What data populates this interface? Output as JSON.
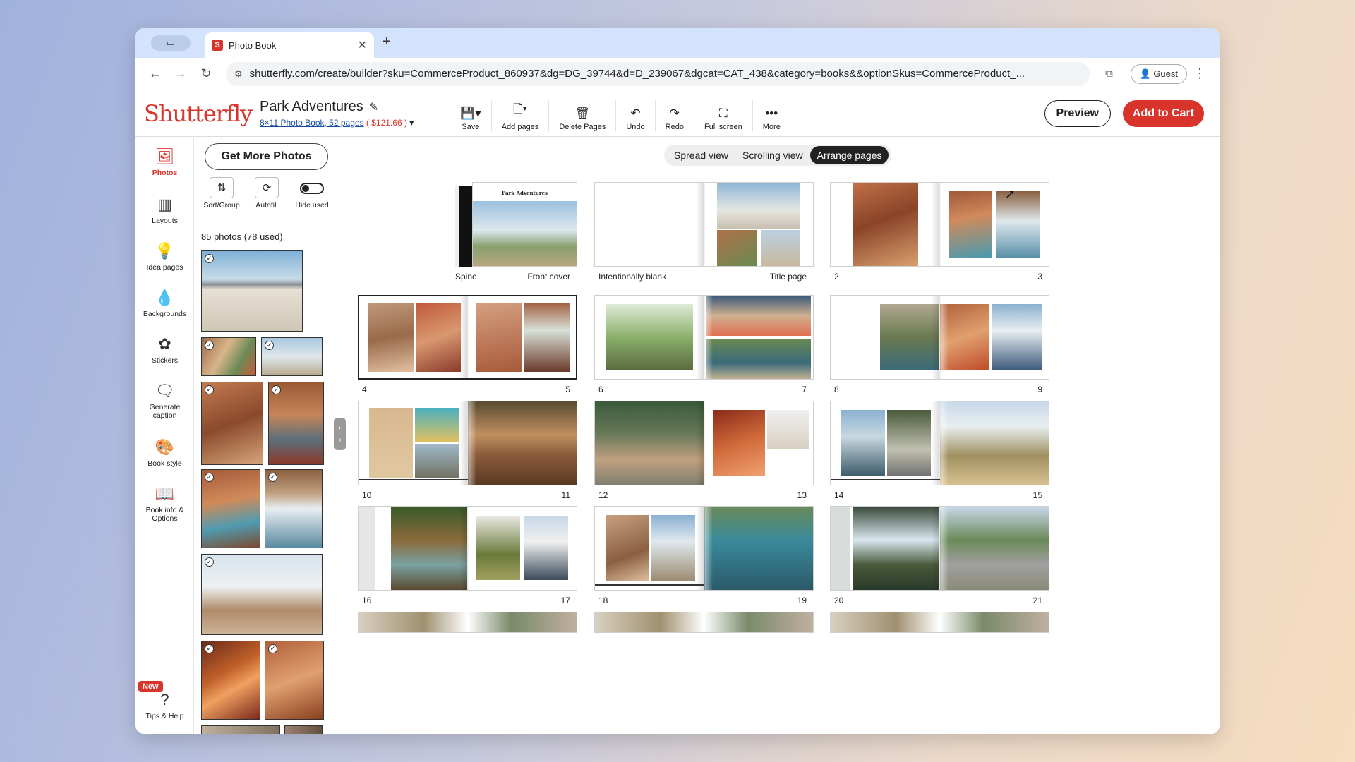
{
  "browser": {
    "tab_title": "Photo Book",
    "favicon_letter": "S",
    "url": "shutterfly.com/create/builder?sku=CommerceProduct_860937&dg=DG_39744&d=D_239067&dgcat=CAT_438&category=books&&optionSkus=CommerceProduct_...",
    "profile_label": "Guest"
  },
  "app": {
    "logo": "Shutterfly",
    "project_title": "Park Adventures",
    "product_desc": "8×11 Photo Book, 52 pages",
    "price": "( $121.66 )",
    "toolbar": [
      "Save",
      "Add pages",
      "Delete Pages",
      "Undo",
      "Redo",
      "Full screen",
      "More"
    ],
    "preview_label": "Preview",
    "cart_label": "Add to Cart"
  },
  "sidebar": {
    "items": [
      "Photos",
      "Layouts",
      "Idea pages",
      "Backgrounds",
      "Stickers",
      "Generate caption",
      "Book style",
      "Book info & Options"
    ],
    "help_label": "Tips & Help",
    "new_badge": "New"
  },
  "panel": {
    "get_more_label": "Get More Photos",
    "tools": [
      "Sort/Group",
      "Autofill",
      "Hide used"
    ],
    "count_text": "85 photos (78 used)"
  },
  "views": {
    "options": [
      "Spread view",
      "Scrolling view",
      "Arrange pages"
    ],
    "selected": "Arrange pages"
  },
  "spreads": [
    {
      "left": "Spine",
      "right": "Front cover",
      "cover_title": "Park Adventures"
    },
    {
      "left": "Intentionally blank",
      "right": "Title page"
    },
    {
      "left": "2",
      "right": "3"
    },
    {
      "left": "4",
      "right": "5"
    },
    {
      "left": "6",
      "right": "7"
    },
    {
      "left": "8",
      "right": "9"
    },
    {
      "left": "10",
      "right": "11"
    },
    {
      "left": "12",
      "right": "13"
    },
    {
      "left": "14",
      "right": "15"
    },
    {
      "left": "16",
      "right": "17"
    },
    {
      "left": "18",
      "right": "19"
    },
    {
      "left": "20",
      "right": "21"
    }
  ],
  "colors": {
    "brand": "#d9342b",
    "tab_bar": "#d3e3fd",
    "selected_view": "#222222"
  }
}
